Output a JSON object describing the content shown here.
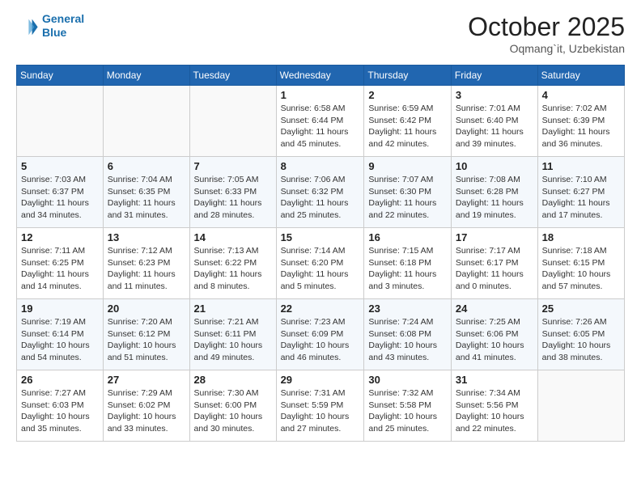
{
  "header": {
    "logo_line1": "General",
    "logo_line2": "Blue",
    "month": "October 2025",
    "location": "Oqmang`it, Uzbekistan"
  },
  "weekdays": [
    "Sunday",
    "Monday",
    "Tuesday",
    "Wednesday",
    "Thursday",
    "Friday",
    "Saturday"
  ],
  "weeks": [
    [
      {
        "day": "",
        "info": ""
      },
      {
        "day": "",
        "info": ""
      },
      {
        "day": "",
        "info": ""
      },
      {
        "day": "1",
        "info": "Sunrise: 6:58 AM\nSunset: 6:44 PM\nDaylight: 11 hours\nand 45 minutes."
      },
      {
        "day": "2",
        "info": "Sunrise: 6:59 AM\nSunset: 6:42 PM\nDaylight: 11 hours\nand 42 minutes."
      },
      {
        "day": "3",
        "info": "Sunrise: 7:01 AM\nSunset: 6:40 PM\nDaylight: 11 hours\nand 39 minutes."
      },
      {
        "day": "4",
        "info": "Sunrise: 7:02 AM\nSunset: 6:39 PM\nDaylight: 11 hours\nand 36 minutes."
      }
    ],
    [
      {
        "day": "5",
        "info": "Sunrise: 7:03 AM\nSunset: 6:37 PM\nDaylight: 11 hours\nand 34 minutes."
      },
      {
        "day": "6",
        "info": "Sunrise: 7:04 AM\nSunset: 6:35 PM\nDaylight: 11 hours\nand 31 minutes."
      },
      {
        "day": "7",
        "info": "Sunrise: 7:05 AM\nSunset: 6:33 PM\nDaylight: 11 hours\nand 28 minutes."
      },
      {
        "day": "8",
        "info": "Sunrise: 7:06 AM\nSunset: 6:32 PM\nDaylight: 11 hours\nand 25 minutes."
      },
      {
        "day": "9",
        "info": "Sunrise: 7:07 AM\nSunset: 6:30 PM\nDaylight: 11 hours\nand 22 minutes."
      },
      {
        "day": "10",
        "info": "Sunrise: 7:08 AM\nSunset: 6:28 PM\nDaylight: 11 hours\nand 19 minutes."
      },
      {
        "day": "11",
        "info": "Sunrise: 7:10 AM\nSunset: 6:27 PM\nDaylight: 11 hours\nand 17 minutes."
      }
    ],
    [
      {
        "day": "12",
        "info": "Sunrise: 7:11 AM\nSunset: 6:25 PM\nDaylight: 11 hours\nand 14 minutes."
      },
      {
        "day": "13",
        "info": "Sunrise: 7:12 AM\nSunset: 6:23 PM\nDaylight: 11 hours\nand 11 minutes."
      },
      {
        "day": "14",
        "info": "Sunrise: 7:13 AM\nSunset: 6:22 PM\nDaylight: 11 hours\nand 8 minutes."
      },
      {
        "day": "15",
        "info": "Sunrise: 7:14 AM\nSunset: 6:20 PM\nDaylight: 11 hours\nand 5 minutes."
      },
      {
        "day": "16",
        "info": "Sunrise: 7:15 AM\nSunset: 6:18 PM\nDaylight: 11 hours\nand 3 minutes."
      },
      {
        "day": "17",
        "info": "Sunrise: 7:17 AM\nSunset: 6:17 PM\nDaylight: 11 hours\nand 0 minutes."
      },
      {
        "day": "18",
        "info": "Sunrise: 7:18 AM\nSunset: 6:15 PM\nDaylight: 10 hours\nand 57 minutes."
      }
    ],
    [
      {
        "day": "19",
        "info": "Sunrise: 7:19 AM\nSunset: 6:14 PM\nDaylight: 10 hours\nand 54 minutes."
      },
      {
        "day": "20",
        "info": "Sunrise: 7:20 AM\nSunset: 6:12 PM\nDaylight: 10 hours\nand 51 minutes."
      },
      {
        "day": "21",
        "info": "Sunrise: 7:21 AM\nSunset: 6:11 PM\nDaylight: 10 hours\nand 49 minutes."
      },
      {
        "day": "22",
        "info": "Sunrise: 7:23 AM\nSunset: 6:09 PM\nDaylight: 10 hours\nand 46 minutes."
      },
      {
        "day": "23",
        "info": "Sunrise: 7:24 AM\nSunset: 6:08 PM\nDaylight: 10 hours\nand 43 minutes."
      },
      {
        "day": "24",
        "info": "Sunrise: 7:25 AM\nSunset: 6:06 PM\nDaylight: 10 hours\nand 41 minutes."
      },
      {
        "day": "25",
        "info": "Sunrise: 7:26 AM\nSunset: 6:05 PM\nDaylight: 10 hours\nand 38 minutes."
      }
    ],
    [
      {
        "day": "26",
        "info": "Sunrise: 7:27 AM\nSunset: 6:03 PM\nDaylight: 10 hours\nand 35 minutes."
      },
      {
        "day": "27",
        "info": "Sunrise: 7:29 AM\nSunset: 6:02 PM\nDaylight: 10 hours\nand 33 minutes."
      },
      {
        "day": "28",
        "info": "Sunrise: 7:30 AM\nSunset: 6:00 PM\nDaylight: 10 hours\nand 30 minutes."
      },
      {
        "day": "29",
        "info": "Sunrise: 7:31 AM\nSunset: 5:59 PM\nDaylight: 10 hours\nand 27 minutes."
      },
      {
        "day": "30",
        "info": "Sunrise: 7:32 AM\nSunset: 5:58 PM\nDaylight: 10 hours\nand 25 minutes."
      },
      {
        "day": "31",
        "info": "Sunrise: 7:34 AM\nSunset: 5:56 PM\nDaylight: 10 hours\nand 22 minutes."
      },
      {
        "day": "",
        "info": ""
      }
    ]
  ]
}
